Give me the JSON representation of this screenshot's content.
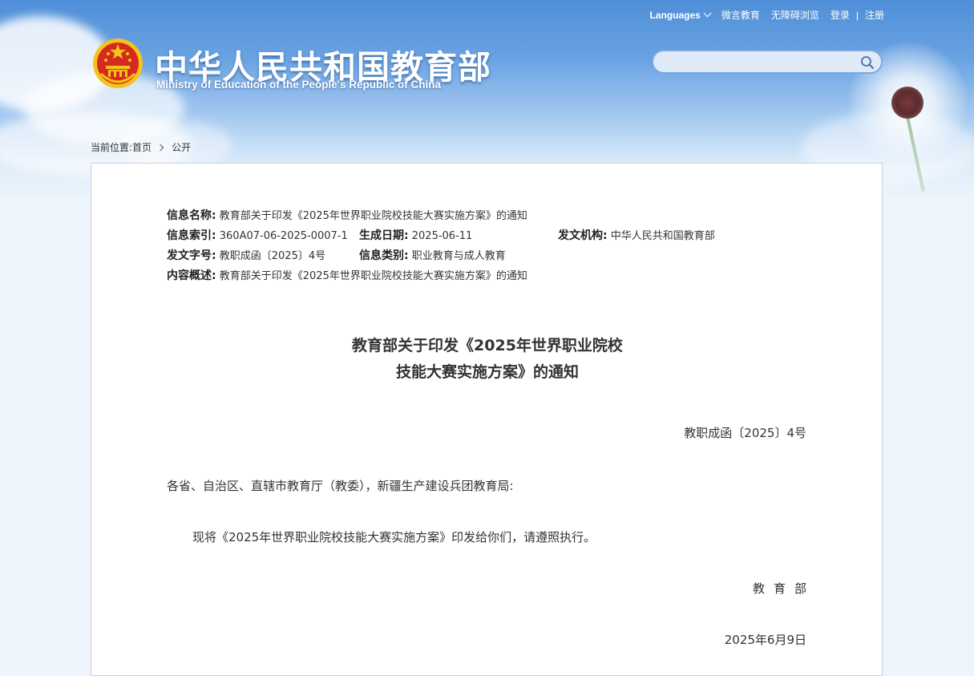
{
  "header": {
    "title_cn": "中华人民共和国教育部",
    "title_en": "Ministry of Education of the People's Republic of China",
    "nav": {
      "languages": "Languages",
      "weiyan": "微言教育",
      "accessible": "无障碍浏览",
      "login": "登录",
      "separator": "|",
      "register": "注册"
    },
    "search": {
      "placeholder": ""
    }
  },
  "breadcrumb": {
    "prefix": "当前位置:",
    "home": "首页",
    "current": "公开"
  },
  "meta": {
    "name_label": "信息名称:",
    "name_value": "教育部关于印发《2025年世界职业院校技能大赛实施方案》的通知",
    "index_label": "信息索引:",
    "index_value": "360A07-06-2025-0007-1",
    "date_label": "生成日期:",
    "date_value": "2025-06-11",
    "org_label": "发文机构:",
    "org_value": "中华人民共和国教育部",
    "docno_label": "发文字号:",
    "docno_value": "教职成函〔2025〕4号",
    "category_label": "信息类别:",
    "category_value": "职业教育与成人教育",
    "summary_label": "内容概述:",
    "summary_value": "教育部关于印发《2025年世界职业院校技能大赛实施方案》的通知"
  },
  "document": {
    "title_line1": "教育部关于印发《2025年世界职业院校",
    "title_line2": "技能大赛实施方案》的通知",
    "doc_number": "教职成函〔2025〕4号",
    "addressee": "各省、自治区、直辖市教育厅（教委），新疆生产建设兵团教育局:",
    "body": "现将《2025年世界职业院校技能大赛实施方案》印发给你们，请遵照执行。",
    "issuer": "教育部",
    "date": "2025年6月9日"
  },
  "colors": {
    "header_blue": "#4f8fd8",
    "search_border": "#7ea6e4",
    "panel_border": "#c9d3dd",
    "emblem_red": "#d52b1e",
    "emblem_gold": "#f6c21c"
  },
  "icons": [
    "national-emblem-icon",
    "chevron-down-icon",
    "search-icon",
    "breadcrumb-arrow-icon"
  ]
}
